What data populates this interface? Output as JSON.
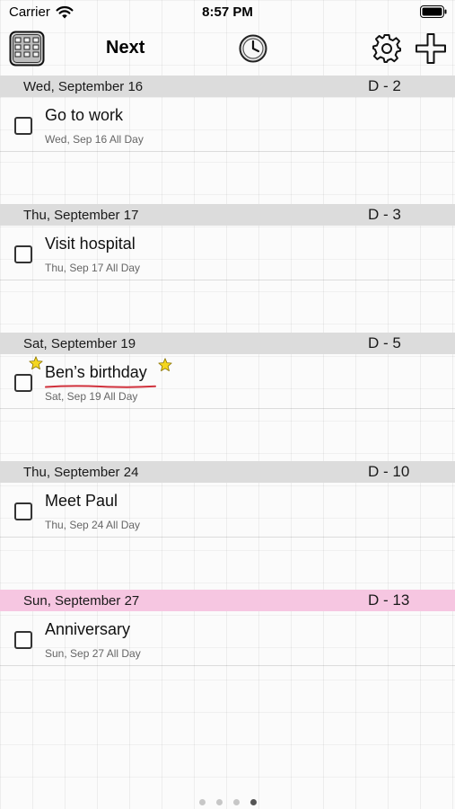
{
  "status_bar": {
    "carrier": "Carrier",
    "time": "8:57 PM",
    "wifi_icon": "wifi-icon",
    "battery_icon": "battery-icon"
  },
  "nav_bar": {
    "title": "Next",
    "left_icon": "calendar-grid-icon",
    "center_icon": "history-clock-icon",
    "right_icons": [
      "settings-gear-icon",
      "add-plus-icon"
    ]
  },
  "days": [
    {
      "date": "Wed, September 16",
      "countdown": "D - 2",
      "header_color": "#dcdcdc",
      "event": {
        "title": "Go to work",
        "subtitle": "Wed, Sep 16 All Day",
        "starred": false
      }
    },
    {
      "date": "Thu, September 17",
      "countdown": "D - 3",
      "header_color": "#dcdcdc",
      "event": {
        "title": "Visit hospital",
        "subtitle": "Thu, Sep 17 All Day",
        "starred": false
      }
    },
    {
      "date": "Sat, September 19",
      "countdown": "D - 5",
      "header_color": "#dcdcdc",
      "event": {
        "title": "Ben’s birthday",
        "subtitle": "Sat, Sep 19 All Day",
        "starred": true,
        "underline_color": "#d0313c",
        "star_color": "#f4d61f"
      }
    },
    {
      "date": "Thu, September 24",
      "countdown": "D - 10",
      "header_color": "#dcdcdc",
      "event": {
        "title": "Meet Paul",
        "subtitle": "Thu, Sep 24 All Day",
        "starred": false
      }
    },
    {
      "date": "Sun, September 27",
      "countdown": "D - 13",
      "header_color": "#f6c6e1",
      "event": {
        "title": "Anniversary",
        "subtitle": "Sun, Sep 27 All Day",
        "starred": false
      }
    }
  ],
  "page_indicator": {
    "count": 4,
    "active_index": 3
  }
}
